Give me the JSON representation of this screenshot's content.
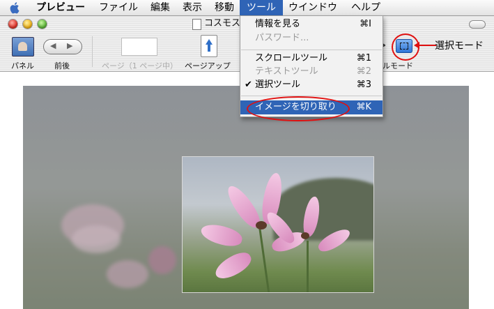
{
  "menubar": {
    "app_name": "プレビュー",
    "items": [
      "ファイル",
      "編集",
      "表示",
      "移動",
      "ツール",
      "ウインドウ",
      "ヘルプ"
    ],
    "active": "ツール"
  },
  "window": {
    "title": "コスモス"
  },
  "toolbar": {
    "panel_label": "パネル",
    "nav_label": "前後",
    "page_label": "ページ（1 ページ中）",
    "pageup_label": "ページアップ",
    "mode_label": "ールモード"
  },
  "dropdown": {
    "items": [
      {
        "label": "情報を見る",
        "shortcut": "⌘I",
        "state": "normal"
      },
      {
        "label": "パスワード...",
        "shortcut": "",
        "state": "disabled"
      },
      {
        "label": "スクロールツール",
        "shortcut": "⌘1",
        "state": "normal"
      },
      {
        "label": "テキストツール",
        "shortcut": "⌘2",
        "state": "disabled"
      },
      {
        "label": "選択ツール",
        "shortcut": "⌘3",
        "state": "checked"
      },
      {
        "label": "イメージを切り取り",
        "shortcut": "⌘K",
        "state": "selected"
      }
    ],
    "check_glyph": "✔"
  },
  "annotations": {
    "select_mode_label": "選択モード"
  },
  "colors": {
    "highlight": "#2f64b6",
    "annotation": "#e01010"
  }
}
